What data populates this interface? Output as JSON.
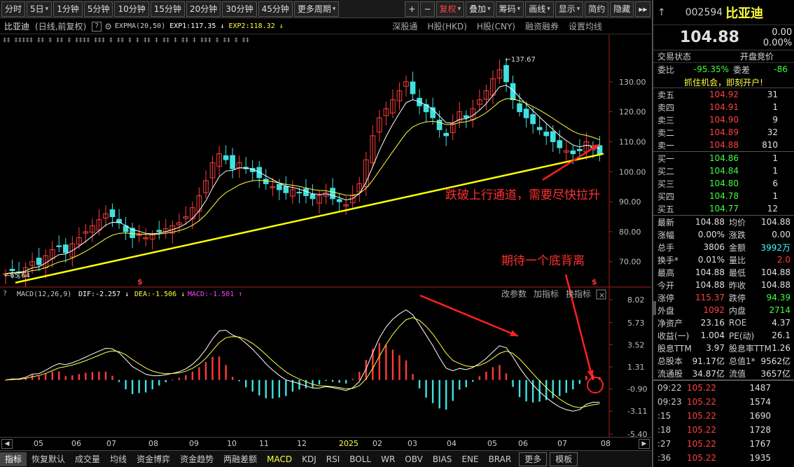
{
  "toolbar": {
    "buttons": [
      "分时",
      "5日",
      "1分钟",
      "5分钟",
      "10分钟",
      "15分钟",
      "20分钟",
      "30分钟",
      "45分钟",
      "更多周期"
    ],
    "right_buttons": [
      "+",
      "−",
      "复权",
      "叠加",
      "筹码",
      "画线",
      "显示",
      "简约",
      "隐藏",
      "▸▸"
    ]
  },
  "info": {
    "stock": "比亚迪",
    "mode": "(日线,前复权)",
    "indicator": "EXPMA(20,50)",
    "exp1": "EXP1:117.35",
    "exp2": "EXP2:118.32",
    "links": [
      "深股通",
      "H股(HKD)",
      "H股(CNY)",
      "融资融券",
      "设置均线"
    ]
  },
  "macd_info": {
    "name": "MACD(12,26,9)",
    "dif": "DIF:-2.257",
    "dea": "DEA:-1.506",
    "macd": "MACD:-1.501",
    "links": [
      "改参数",
      "加指标",
      "换指标"
    ]
  },
  "annotations": {
    "text1": "跌破上行通道，需要尽快拉升",
    "text2": "期待一个底背离",
    "high": "137.67",
    "low": "65.64"
  },
  "axis": {
    "price_ticks": [
      "130.00",
      "120.00",
      "110.00",
      "100.00",
      "90.00",
      "80.00",
      "70.00"
    ],
    "macd_ticks": [
      "8.02",
      "5.73",
      "3.52",
      "1.31",
      "-0.90",
      "-3.11",
      "-5.40"
    ],
    "months": [
      "05",
      "06",
      "07",
      "08",
      "09",
      "10",
      "11",
      "12",
      "2025",
      "02",
      "03",
      "04",
      "05",
      "06",
      "07",
      "08"
    ]
  },
  "tabs": [
    "指标",
    "恢复默认",
    "成交量",
    "均线",
    "资金博弈",
    "资金趋势",
    "两融差额",
    "MACD",
    "KDJ",
    "RSI",
    "BOLL",
    "WR",
    "OBV",
    "BIAS",
    "ENE",
    "BRAR",
    "更多",
    "模板"
  ],
  "panel": {
    "code": "002594",
    "name": "比亚迪",
    "price": "104.88",
    "change": "0.00",
    "change_pct": "0.00%",
    "status_label": "交易状态",
    "status_value": "开盘竞价",
    "weibi_label": "委比",
    "weibi_value": "-95.35%",
    "weicha_label": "委差",
    "weicha_value": "-86",
    "promo": "抓住机会，即刻开户!",
    "asks": [
      {
        "label": "卖五",
        "price": "104.92",
        "vol": "31"
      },
      {
        "label": "卖四",
        "price": "104.91",
        "vol": "1"
      },
      {
        "label": "卖三",
        "price": "104.90",
        "vol": "9"
      },
      {
        "label": "卖二",
        "price": "104.89",
        "vol": "32"
      },
      {
        "label": "卖一",
        "price": "104.88",
        "vol": "810"
      }
    ],
    "bids": [
      {
        "label": "买一",
        "price": "104.86",
        "vol": "1"
      },
      {
        "label": "买二",
        "price": "104.84",
        "vol": "1"
      },
      {
        "label": "买三",
        "price": "104.80",
        "vol": "6"
      },
      {
        "label": "买四",
        "price": "104.78",
        "vol": "1"
      },
      {
        "label": "买五",
        "price": "104.77",
        "vol": "12"
      }
    ],
    "stats": [
      {
        "k": "最新",
        "v": "104.88",
        "vc": "white",
        "k2": "均价",
        "v2": "104.88",
        "v2c": "white"
      },
      {
        "k": "涨幅",
        "v": "0.00%",
        "vc": "white",
        "k2": "涨跌",
        "v2": "0.00",
        "v2c": "white"
      },
      {
        "k": "总手",
        "v": "3806",
        "vc": "white",
        "k2": "金额",
        "v2": "3992万",
        "v2c": "cyan"
      },
      {
        "k": "换手*",
        "v": "0.01%",
        "vc": "white",
        "k2": "量比",
        "v2": "2.0",
        "v2c": "red"
      },
      {
        "k": "最高",
        "v": "104.88",
        "vc": "white",
        "k2": "最低",
        "v2": "104.88",
        "v2c": "white"
      },
      {
        "k": "今开",
        "v": "104.88",
        "vc": "white",
        "k2": "昨收",
        "v2": "104.88",
        "v2c": "white"
      },
      {
        "k": "涨停",
        "v": "115.37",
        "vc": "red",
        "k2": "跌停",
        "v2": "94.39",
        "v2c": "green"
      },
      {
        "k": "外盘",
        "v": "1092",
        "vc": "red",
        "k2": "内盘",
        "v2": "2714",
        "v2c": "green"
      },
      {
        "k": "净资产",
        "v": "23.16",
        "vc": "white",
        "k2": "ROE",
        "v2": "4.37",
        "v2c": "white"
      },
      {
        "k": "收益(一)",
        "v": "1.004",
        "vc": "white",
        "k2": "PE(动)",
        "v2": "26.1",
        "v2c": "white"
      },
      {
        "k": "股息TTM",
        "v": "3.97",
        "vc": "white",
        "k2": "股息率TTM",
        "v2": "1.26",
        "v2c": "white"
      },
      {
        "k": "总股本",
        "v": "91.17亿",
        "vc": "white",
        "k2": "总值1*",
        "v2": "9562亿",
        "v2c": "white"
      },
      {
        "k": "流通股",
        "v": "34.87亿",
        "vc": "white",
        "k2": "流值",
        "v2": "3657亿",
        "v2c": "white"
      }
    ],
    "trades": [
      {
        "t": "09:22",
        "p": "105.22",
        "vol": "1487"
      },
      {
        "t": "09:23",
        "p": "105.22",
        "vol": "1574"
      },
      {
        "t": ":15",
        "p": "105.22",
        "vol": "1690"
      },
      {
        "t": ":18",
        "p": "105.22",
        "vol": "1728"
      },
      {
        "t": ":27",
        "p": "105.22",
        "vol": "1767"
      },
      {
        "t": ":36",
        "p": "105.22",
        "vol": "1935"
      }
    ]
  },
  "chart_data": {
    "type": "candlestick",
    "title": "比亚迪 (日线,前复权)",
    "ylim": [
      62,
      140
    ],
    "high": 137.67,
    "low": 65.64,
    "trendline": [
      [
        0,
        63
      ],
      [
        1,
        106
      ]
    ],
    "close_series": [
      66,
      67,
      66.5,
      68,
      70,
      69,
      72,
      74,
      75,
      73,
      76,
      78,
      80,
      82,
      84,
      86,
      85,
      83,
      80,
      78,
      79,
      78,
      79,
      80,
      81,
      82,
      83,
      85,
      88,
      92,
      97,
      103,
      106,
      104,
      101,
      103,
      101,
      100,
      98,
      96,
      95,
      94,
      93,
      94,
      93,
      92,
      91,
      92,
      93,
      91,
      90,
      89,
      92,
      96,
      104,
      112,
      118,
      121,
      124,
      127,
      130,
      126,
      122,
      120,
      118,
      114,
      112,
      116,
      120,
      118,
      121,
      124,
      127,
      131,
      134,
      130,
      124,
      120,
      118,
      116,
      114,
      112,
      110,
      108,
      107,
      106,
      107,
      110,
      108,
      106
    ],
    "macd_ylim": [
      -5.4,
      8.02
    ]
  }
}
